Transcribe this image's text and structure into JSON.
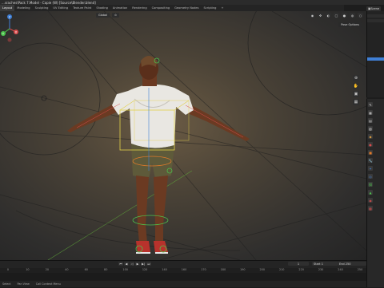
{
  "title_bar": {
    "text": "...sraches\\Pack 7.Model - Copie (W) [Source\\Blender.blend]"
  },
  "top_right": {
    "scene_label": "Scene"
  },
  "workspaces": [
    "Layout",
    "Modeling",
    "Sculpting",
    "UV Editing",
    "Texture Paint",
    "Shading",
    "Animation",
    "Rendering",
    "Compositing",
    "Geometry Nodes",
    "Scripting",
    "+"
  ],
  "active_workspace": "Layout",
  "viewport": {
    "header_left": [
      "Global",
      "⊙"
    ],
    "pose_options": "Pose Options",
    "gizmo_axes": [
      "Z",
      "Y",
      "X"
    ]
  },
  "timeline": {
    "ruler": [
      "0",
      "10",
      "20",
      "40",
      "60",
      "80",
      "100",
      "120",
      "140",
      "160",
      "170",
      "180",
      "190",
      "200",
      "210",
      "220",
      "230",
      "240",
      "250"
    ],
    "current_frame": "1",
    "start_label": "Start",
    "start_value": "1",
    "end_label": "End",
    "end_value": "250"
  },
  "statusbar": {
    "items": [
      "Select",
      "Pan View",
      "Call Context Menu"
    ]
  },
  "colors": {
    "accent_blue": "#3f7fd6",
    "bone_green": "#4cc24c",
    "bone_yellow": "#e3d24a",
    "bone_orange": "#e07a2a"
  }
}
